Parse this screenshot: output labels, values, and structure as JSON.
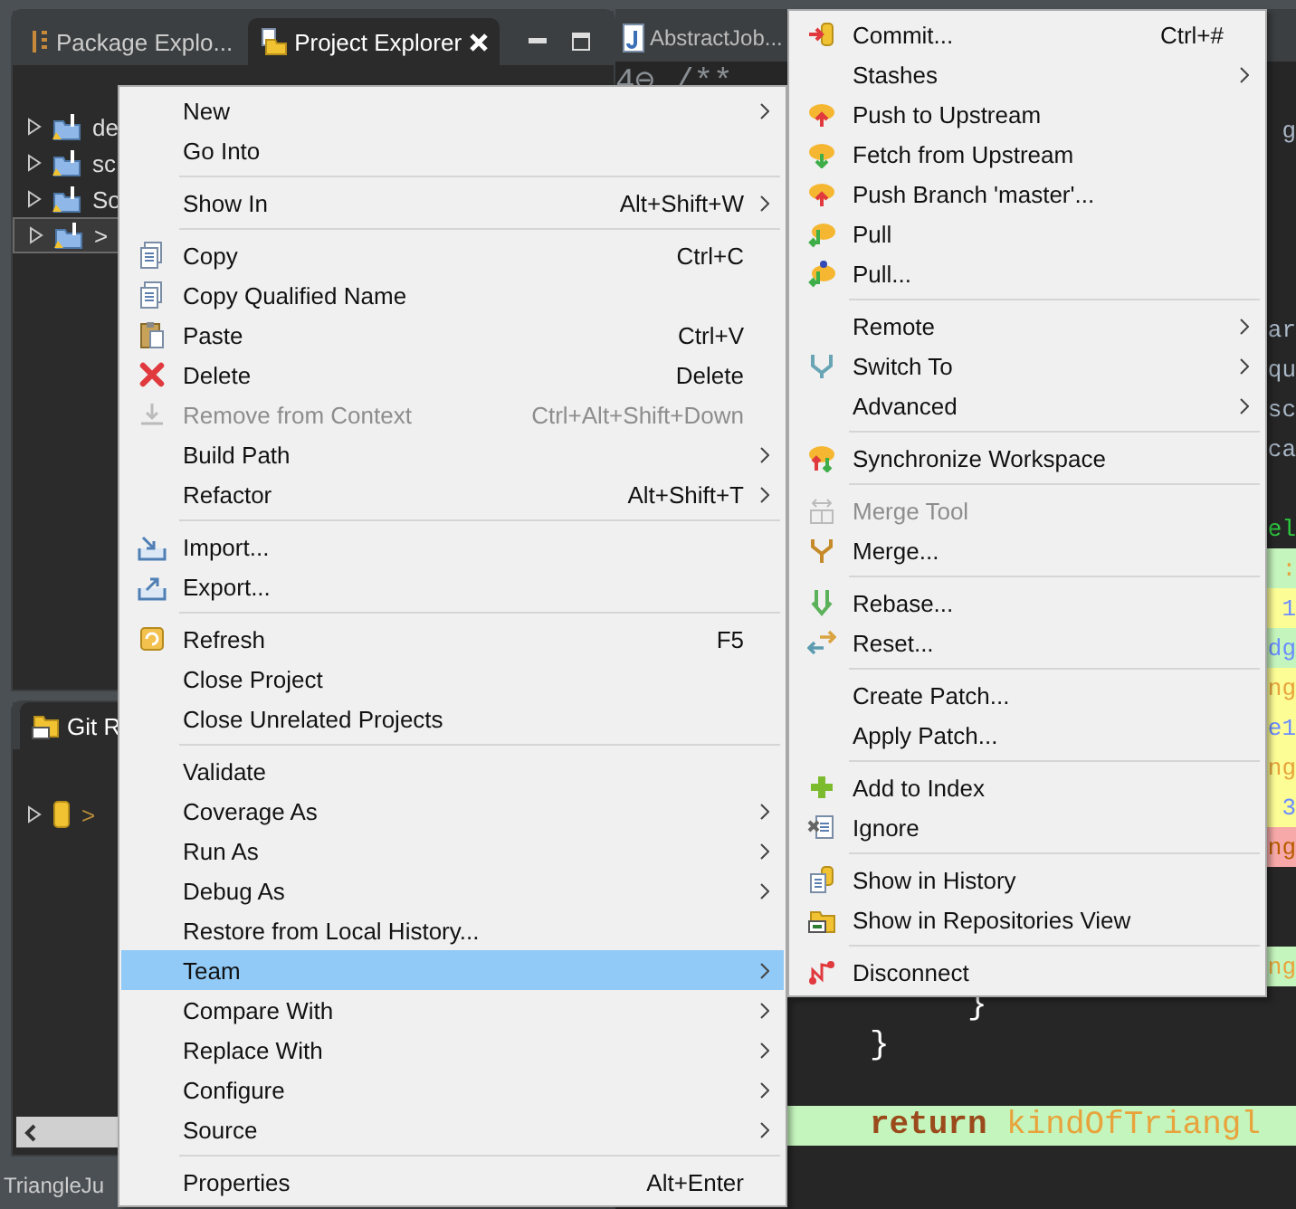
{
  "explorer": {
    "tabs": [
      {
        "label": "Package Explo...",
        "selected": false
      },
      {
        "label": "Project Explorer",
        "selected": true
      }
    ],
    "tree": [
      {
        "label": "de",
        "selected": false
      },
      {
        "label": "sc",
        "selected": false
      },
      {
        "label": "So",
        "selected": false
      },
      {
        "label": ">",
        "selected": true
      }
    ]
  },
  "git_repositories": {
    "title": "Git R",
    "tree": [
      {
        "label": ">"
      }
    ]
  },
  "status_bar": {
    "text": "TriangleJu"
  },
  "editor": {
    "tab": "AbstractJob...",
    "rows": [
      {
        "kind": "code",
        "tokens": [
          {
            "text": "4⊖ /**",
            "color": "#8a8f94"
          }
        ]
      },
      {
        "kind": "edge",
        "tokens": [
          {
            "text": "g",
            "color": "#a9b7c6"
          }
        ]
      },
      {
        "kind": "blank"
      },
      {
        "kind": "blank"
      },
      {
        "kind": "blank"
      },
      {
        "kind": "blank"
      },
      {
        "kind": "edge",
        "tokens": [
          {
            "text": "ar",
            "color": "#a9b7c6"
          }
        ]
      },
      {
        "kind": "edge",
        "tokens": [
          {
            "text": "qu",
            "color": "#a9b7c6"
          }
        ]
      },
      {
        "kind": "edge",
        "tokens": [
          {
            "text": "sc",
            "color": "#a9b7c6"
          }
        ]
      },
      {
        "kind": "edge",
        "tokens": [
          {
            "text": "ca",
            "color": "#a9b7c6"
          }
        ]
      },
      {
        "kind": "blank"
      },
      {
        "kind": "edge",
        "tokens": [
          {
            "text": "el",
            "color": "#2ecc40"
          }
        ]
      },
      {
        "kind": "edge",
        "tokens": [
          {
            "text": ":",
            "color": "#e8a33c"
          }
        ],
        "color": "#c4f5bc"
      },
      {
        "kind": "edge",
        "tokens": [
          {
            "text": "1",
            "color": "#6b8cff"
          }
        ],
        "color": "#fdfd96"
      },
      {
        "kind": "edge",
        "tokens": [
          {
            "text": "dg",
            "color": "#6b8cff"
          }
        ],
        "color": "#c4f5bc"
      },
      {
        "kind": "edge",
        "tokens": [
          {
            "text": "ng",
            "color": "#e8a33c"
          }
        ],
        "color": "#fdfd96"
      },
      {
        "kind": "edge",
        "tokens": [
          {
            "text": "e1",
            "color": "#6b8cff"
          }
        ],
        "color": "#fdfd96"
      },
      {
        "kind": "edge",
        "tokens": [
          {
            "text": "ng",
            "color": "#e8a33c"
          }
        ],
        "color": "#fdfd96"
      },
      {
        "kind": "edge",
        "tokens": [
          {
            "text": "3",
            "color": "#6b8cff"
          }
        ],
        "color": "#fdfd96"
      },
      {
        "kind": "edge",
        "tokens": [
          {
            "text": "ng",
            "color": "#b85c00"
          }
        ],
        "color": "#f7a8a8"
      },
      {
        "kind": "blank"
      },
      {
        "kind": "blank"
      },
      {
        "kind": "edge",
        "tokens": [
          {
            "text": "ng",
            "color": "#e8a33c"
          }
        ],
        "color": "#c4f5bc"
      },
      {
        "kind": "code",
        "tokens": [
          {
            "text": "                  }",
            "color": "#ffffff"
          }
        ]
      },
      {
        "kind": "code",
        "tokens": [
          {
            "text": "             }",
            "color": "#ffffff"
          }
        ]
      },
      {
        "kind": "blank"
      },
      {
        "kind": "code",
        "tokens": [
          {
            "text": "             return",
            "color": "#9b4a1c"
          },
          {
            "text": " kindOfTriangl",
            "color": "#e8a33c"
          }
        ],
        "color": "#c4f5bc"
      }
    ]
  },
  "context_menu": {
    "groups": [
      {
        "items": [
          {
            "label": "New",
            "submenu": true,
            "disabled": false,
            "selected": false
          },
          {
            "label": "Go Into",
            "disabled": false,
            "selected": false
          }
        ]
      },
      {
        "items": [
          {
            "label": "Show In",
            "shortcut": "Alt+Shift+W",
            "submenu": true,
            "disabled": false,
            "selected": false
          }
        ]
      },
      {
        "items": [
          {
            "label": "Copy",
            "shortcut": "Ctrl+C",
            "disabled": false,
            "selected": false
          },
          {
            "label": "Copy Qualified Name",
            "disabled": false,
            "selected": false
          },
          {
            "label": "Paste",
            "shortcut": "Ctrl+V",
            "disabled": false,
            "selected": false
          },
          {
            "label": "Delete",
            "shortcut": "Delete",
            "disabled": false,
            "selected": false
          },
          {
            "label": "Remove from Context",
            "shortcut": "Ctrl+Alt+Shift+Down",
            "disabled": true,
            "selected": false
          },
          {
            "label": "Build Path",
            "submenu": true,
            "disabled": false,
            "selected": false
          },
          {
            "label": "Refactor",
            "shortcut": "Alt+Shift+T",
            "submenu": true,
            "disabled": false,
            "selected": false
          }
        ]
      },
      {
        "items": [
          {
            "label": "Import...",
            "disabled": false,
            "selected": false
          },
          {
            "label": "Export...",
            "disabled": false,
            "selected": false
          }
        ]
      },
      {
        "items": [
          {
            "label": "Refresh",
            "shortcut": "F5",
            "disabled": false,
            "selected": false
          },
          {
            "label": "Close Project",
            "disabled": false,
            "selected": false
          },
          {
            "label": "Close Unrelated Projects",
            "disabled": false,
            "selected": false
          }
        ]
      },
      {
        "items": [
          {
            "label": "Validate",
            "disabled": false,
            "selected": false
          },
          {
            "label": "Coverage As",
            "submenu": true,
            "disabled": false,
            "selected": false
          },
          {
            "label": "Run As",
            "submenu": true,
            "disabled": false,
            "selected": false
          },
          {
            "label": "Debug As",
            "submenu": true,
            "disabled": false,
            "selected": false
          },
          {
            "label": "Restore from Local History...",
            "disabled": false,
            "selected": false
          },
          {
            "label": "Team",
            "submenu": true,
            "disabled": false,
            "selected": true
          },
          {
            "label": "Compare With",
            "submenu": true,
            "disabled": false,
            "selected": false
          },
          {
            "label": "Replace With",
            "submenu": true,
            "disabled": false,
            "selected": false
          },
          {
            "label": "Configure",
            "submenu": true,
            "disabled": false,
            "selected": false
          },
          {
            "label": "Source",
            "submenu": true,
            "disabled": false,
            "selected": false
          }
        ]
      },
      {
        "items": [
          {
            "label": "Properties",
            "shortcut": "Alt+Enter",
            "disabled": false,
            "selected": false
          }
        ]
      }
    ]
  },
  "team_menu": {
    "groups": [
      {
        "items": [
          {
            "label": "Commit...",
            "shortcut": "Ctrl+#",
            "disabled": false,
            "selected": false
          },
          {
            "label": "Stashes",
            "submenu": true,
            "disabled": false,
            "selected": false
          },
          {
            "label": "Push to Upstream",
            "disabled": false,
            "selected": false
          },
          {
            "label": "Fetch from Upstream",
            "disabled": false,
            "selected": false
          },
          {
            "label": "Push Branch 'master'...",
            "disabled": false,
            "selected": false
          },
          {
            "label": "Pull",
            "disabled": false,
            "selected": false
          },
          {
            "label": "Pull...",
            "disabled": false,
            "selected": false
          }
        ]
      },
      {
        "items": [
          {
            "label": "Remote",
            "submenu": true,
            "disabled": false,
            "selected": false
          },
          {
            "label": "Switch To",
            "submenu": true,
            "disabled": false,
            "selected": false
          },
          {
            "label": "Advanced",
            "submenu": true,
            "disabled": false,
            "selected": false
          }
        ]
      },
      {
        "items": [
          {
            "label": "Synchronize Workspace",
            "disabled": false,
            "selected": false
          }
        ]
      },
      {
        "items": [
          {
            "label": "Merge Tool",
            "disabled": true,
            "selected": false
          },
          {
            "label": "Merge...",
            "disabled": false,
            "selected": false
          }
        ]
      },
      {
        "items": [
          {
            "label": "Rebase...",
            "disabled": false,
            "selected": false
          },
          {
            "label": "Reset...",
            "disabled": false,
            "selected": false
          }
        ]
      },
      {
        "items": [
          {
            "label": "Create Patch...",
            "disabled": false,
            "selected": false
          },
          {
            "label": "Apply Patch...",
            "disabled": false,
            "selected": false
          }
        ]
      },
      {
        "items": [
          {
            "label": "Add to Index",
            "disabled": false,
            "selected": false
          },
          {
            "label": "Ignore",
            "disabled": false,
            "selected": false
          }
        ]
      },
      {
        "items": [
          {
            "label": "Show in History",
            "disabled": false,
            "selected": false
          },
          {
            "label": "Show in Repositories View",
            "disabled": false,
            "selected": false
          }
        ]
      },
      {
        "items": [
          {
            "label": "Disconnect",
            "disabled": false,
            "selected": false
          }
        ]
      }
    ]
  }
}
